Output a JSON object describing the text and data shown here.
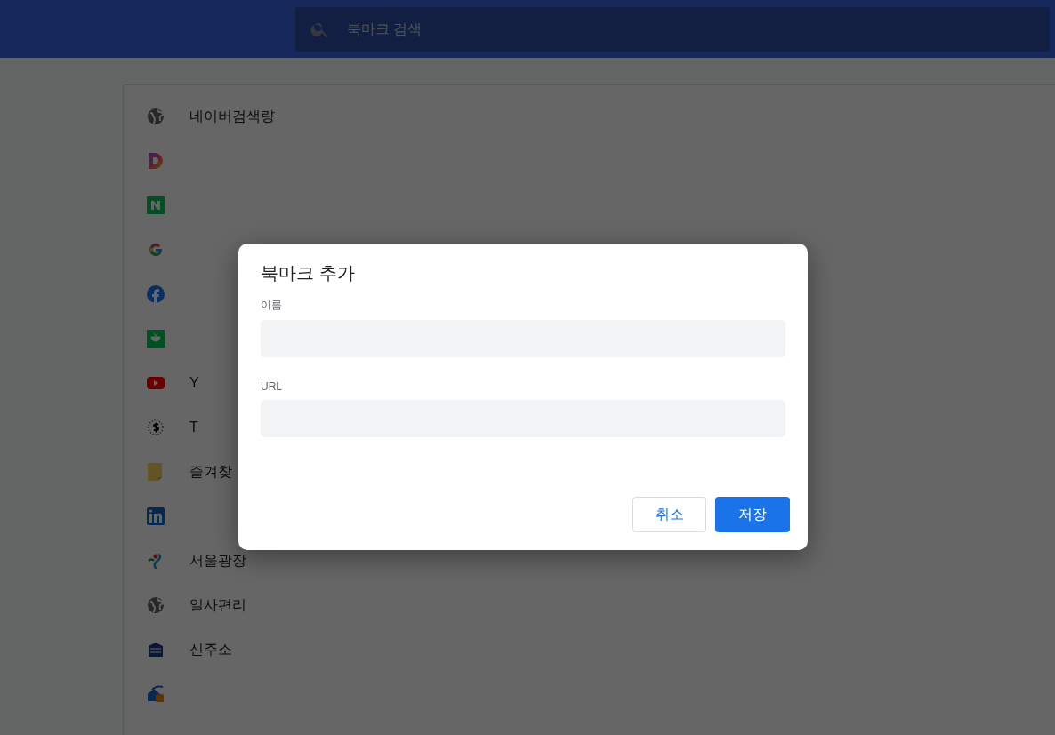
{
  "header": {
    "search": {
      "placeholder": "북마크 검색"
    }
  },
  "bookmarks": [
    {
      "kind": "globe",
      "title": "네이버검색량"
    },
    {
      "kind": "daum"
    },
    {
      "kind": "naver"
    },
    {
      "kind": "google"
    },
    {
      "kind": "facebook"
    },
    {
      "kind": "cafe"
    },
    {
      "kind": "youtube",
      "title": "Y"
    },
    {
      "kind": "dollar",
      "title": "T"
    },
    {
      "kind": "note",
      "title": "즐겨찾"
    },
    {
      "kind": "linkedin"
    },
    {
      "kind": "seoul",
      "title": "서울광장"
    },
    {
      "kind": "globe",
      "title": "일사편리"
    },
    {
      "kind": "address",
      "title": "신주소"
    },
    {
      "kind": "house"
    }
  ],
  "dialog": {
    "title": "북마크 추가",
    "fields": [
      {
        "label": "이름"
      },
      {
        "label": "URL"
      }
    ],
    "buttons": [
      {
        "label": "취소",
        "kind": "secondary"
      },
      {
        "label": "저장",
        "kind": "primary"
      }
    ]
  }
}
